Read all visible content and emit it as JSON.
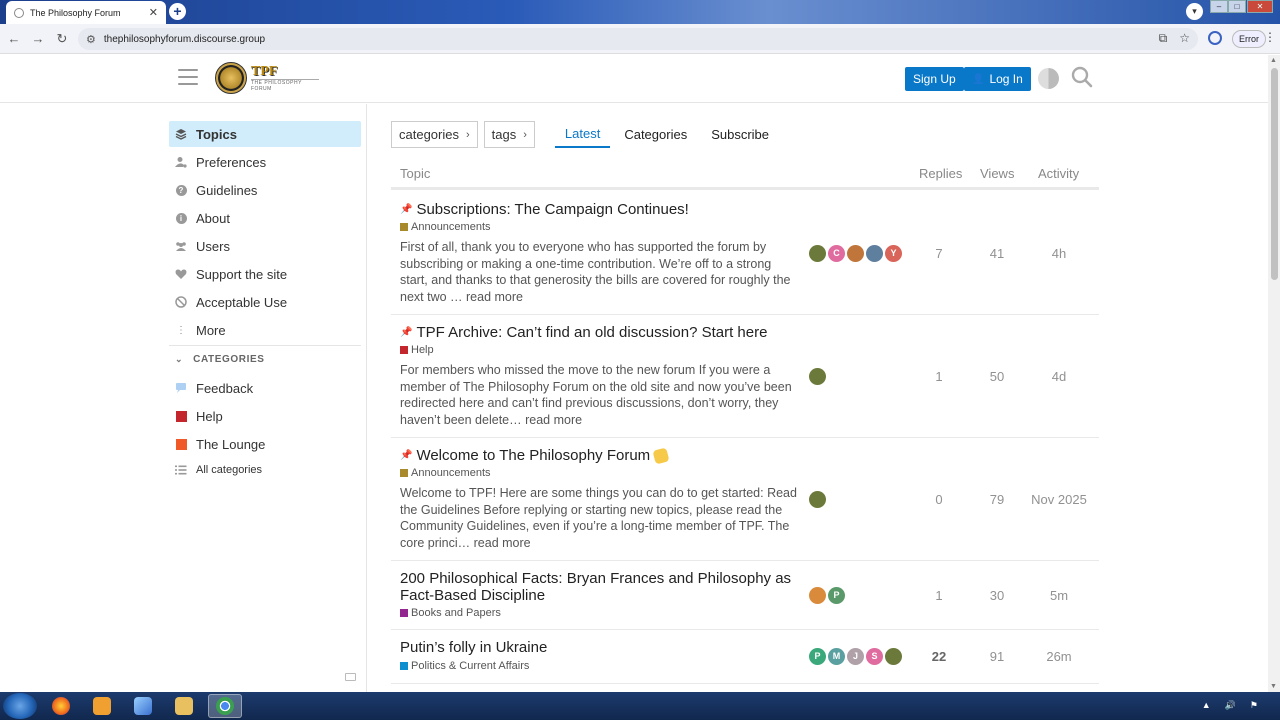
{
  "browser": {
    "tab_title": "The Philosophy Forum",
    "url": "thephilosophyforum.discourse.group",
    "error_label": "Error"
  },
  "header": {
    "logo_text": "TPF",
    "logo_subtext": "THE PHILOSOPHY FORUM",
    "signup_label": "Sign Up",
    "login_label": "Log In"
  },
  "sidebar": {
    "items": [
      {
        "label": "Topics",
        "icon": "layers-icon"
      },
      {
        "label": "Preferences",
        "icon": "user-cog-icon"
      },
      {
        "label": "Guidelines",
        "icon": "question-circle-icon"
      },
      {
        "label": "About",
        "icon": "info-circle-icon"
      },
      {
        "label": "Users",
        "icon": "users-icon"
      },
      {
        "label": "Support the site",
        "icon": "heart-icon"
      },
      {
        "label": "Acceptable Use",
        "icon": "ban-icon"
      },
      {
        "label": "More",
        "icon": "ellipsis-vertical-icon"
      }
    ],
    "categories_heading": "CATEGORIES",
    "categories": [
      {
        "label": "Feedback",
        "color": "#aed0f2"
      },
      {
        "label": "Help",
        "color": "#c4262d"
      },
      {
        "label": "The Lounge",
        "color": "#f05a28"
      }
    ],
    "all_categories": "All categories"
  },
  "nav": {
    "categories_dropdown": "categories",
    "tags_dropdown": "tags",
    "tabs": [
      "Latest",
      "Categories",
      "Subscribe"
    ],
    "active_tab": "Latest"
  },
  "table": {
    "headers": {
      "topic": "Topic",
      "replies": "Replies",
      "views": "Views",
      "activity": "Activity"
    },
    "rows": [
      {
        "pinned": true,
        "title": "Subscriptions: The Campaign Continues!",
        "category": "Announcements",
        "category_color": "#a88a2d",
        "excerpt": "First of all, thank you to everyone who has supported the forum by subscribing or making a one-time contribution. We’re off to a strong start, and thanks to that generosity the bills are covered for roughly the next two … ",
        "read_more": "read more",
        "posters": [
          {
            "letter": "",
            "color": "#6b7a3a"
          },
          {
            "letter": "C",
            "color": "#e06c9f"
          },
          {
            "letter": "",
            "color": "#c0763a"
          },
          {
            "letter": "",
            "color": "#5f7f9f"
          },
          {
            "letter": "Y",
            "color": "#d9645a"
          }
        ],
        "replies": "7",
        "views": "41",
        "activity": "4h"
      },
      {
        "pinned": true,
        "title": "TPF Archive: Can’t find an old discussion? Start here",
        "category": "Help",
        "category_color": "#c4262d",
        "excerpt": "For members who missed the move to the new forum If you were a member of The Philosophy Forum on the old site and now you’ve been redirected here and can’t find previous discussions, don’t worry, they haven’t been delete… ",
        "read_more": "read more",
        "posters": [
          {
            "letter": "",
            "color": "#6b7a3a"
          }
        ],
        "replies": "1",
        "views": "50",
        "activity": "4d"
      },
      {
        "pinned": true,
        "title": "Welcome to The Philosophy Forum",
        "category": "Announcements",
        "category_color": "#a88a2d",
        "excerpt": "Welcome to TPF! Here are some things you can do to get started: Read the Guidelines Before replying or starting new topics, please read the Community Guidelines, even if you’re a long-time member of TPF. The core princi… ",
        "read_more": "read more",
        "posters": [
          {
            "letter": "",
            "color": "#6b7a3a"
          }
        ],
        "replies": "0",
        "views": "79",
        "activity": "Nov 2025"
      },
      {
        "pinned": false,
        "title": "200 Philosophical Facts: Bryan Frances and Philosophy as Fact-Based Discipline",
        "category": "Books and Papers",
        "category_color": "#92278f",
        "posters": [
          {
            "letter": "",
            "color": "#d98a3a"
          },
          {
            "letter": "P",
            "color": "#5a9a6a"
          }
        ],
        "replies": "1",
        "views": "30",
        "activity": "5m"
      },
      {
        "pinned": false,
        "title": "Putin’s folly in Ukraine",
        "category": "Politics & Current Affairs",
        "category_color": "#0e8dcf",
        "posters": [
          {
            "letter": "P",
            "color": "#3aa87a"
          },
          {
            "letter": "M",
            "color": "#5aa0a0"
          },
          {
            "letter": "J",
            "color": "#b0a0a8"
          },
          {
            "letter": "S",
            "color": "#e06c9f"
          },
          {
            "letter": "",
            "color": "#6b7a3a"
          }
        ],
        "replies": "22",
        "views": "91",
        "activity": "26m"
      }
    ]
  }
}
